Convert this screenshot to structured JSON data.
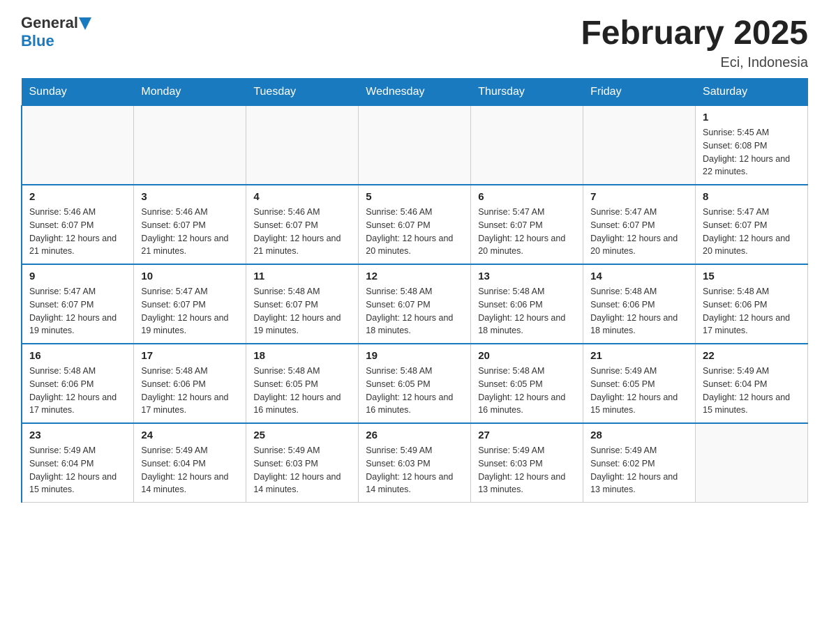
{
  "header": {
    "logo_general": "General",
    "logo_blue": "Blue",
    "title": "February 2025",
    "subtitle": "Eci, Indonesia"
  },
  "days_of_week": [
    "Sunday",
    "Monday",
    "Tuesday",
    "Wednesday",
    "Thursday",
    "Friday",
    "Saturday"
  ],
  "weeks": [
    {
      "cells": [
        {
          "day": "",
          "info": ""
        },
        {
          "day": "",
          "info": ""
        },
        {
          "day": "",
          "info": ""
        },
        {
          "day": "",
          "info": ""
        },
        {
          "day": "",
          "info": ""
        },
        {
          "day": "",
          "info": ""
        },
        {
          "day": "1",
          "info": "Sunrise: 5:45 AM\nSunset: 6:08 PM\nDaylight: 12 hours and 22 minutes."
        }
      ]
    },
    {
      "cells": [
        {
          "day": "2",
          "info": "Sunrise: 5:46 AM\nSunset: 6:07 PM\nDaylight: 12 hours and 21 minutes."
        },
        {
          "day": "3",
          "info": "Sunrise: 5:46 AM\nSunset: 6:07 PM\nDaylight: 12 hours and 21 minutes."
        },
        {
          "day": "4",
          "info": "Sunrise: 5:46 AM\nSunset: 6:07 PM\nDaylight: 12 hours and 21 minutes."
        },
        {
          "day": "5",
          "info": "Sunrise: 5:46 AM\nSunset: 6:07 PM\nDaylight: 12 hours and 20 minutes."
        },
        {
          "day": "6",
          "info": "Sunrise: 5:47 AM\nSunset: 6:07 PM\nDaylight: 12 hours and 20 minutes."
        },
        {
          "day": "7",
          "info": "Sunrise: 5:47 AM\nSunset: 6:07 PM\nDaylight: 12 hours and 20 minutes."
        },
        {
          "day": "8",
          "info": "Sunrise: 5:47 AM\nSunset: 6:07 PM\nDaylight: 12 hours and 20 minutes."
        }
      ]
    },
    {
      "cells": [
        {
          "day": "9",
          "info": "Sunrise: 5:47 AM\nSunset: 6:07 PM\nDaylight: 12 hours and 19 minutes."
        },
        {
          "day": "10",
          "info": "Sunrise: 5:47 AM\nSunset: 6:07 PM\nDaylight: 12 hours and 19 minutes."
        },
        {
          "day": "11",
          "info": "Sunrise: 5:48 AM\nSunset: 6:07 PM\nDaylight: 12 hours and 19 minutes."
        },
        {
          "day": "12",
          "info": "Sunrise: 5:48 AM\nSunset: 6:07 PM\nDaylight: 12 hours and 18 minutes."
        },
        {
          "day": "13",
          "info": "Sunrise: 5:48 AM\nSunset: 6:06 PM\nDaylight: 12 hours and 18 minutes."
        },
        {
          "day": "14",
          "info": "Sunrise: 5:48 AM\nSunset: 6:06 PM\nDaylight: 12 hours and 18 minutes."
        },
        {
          "day": "15",
          "info": "Sunrise: 5:48 AM\nSunset: 6:06 PM\nDaylight: 12 hours and 17 minutes."
        }
      ]
    },
    {
      "cells": [
        {
          "day": "16",
          "info": "Sunrise: 5:48 AM\nSunset: 6:06 PM\nDaylight: 12 hours and 17 minutes."
        },
        {
          "day": "17",
          "info": "Sunrise: 5:48 AM\nSunset: 6:06 PM\nDaylight: 12 hours and 17 minutes."
        },
        {
          "day": "18",
          "info": "Sunrise: 5:48 AM\nSunset: 6:05 PM\nDaylight: 12 hours and 16 minutes."
        },
        {
          "day": "19",
          "info": "Sunrise: 5:48 AM\nSunset: 6:05 PM\nDaylight: 12 hours and 16 minutes."
        },
        {
          "day": "20",
          "info": "Sunrise: 5:48 AM\nSunset: 6:05 PM\nDaylight: 12 hours and 16 minutes."
        },
        {
          "day": "21",
          "info": "Sunrise: 5:49 AM\nSunset: 6:05 PM\nDaylight: 12 hours and 15 minutes."
        },
        {
          "day": "22",
          "info": "Sunrise: 5:49 AM\nSunset: 6:04 PM\nDaylight: 12 hours and 15 minutes."
        }
      ]
    },
    {
      "cells": [
        {
          "day": "23",
          "info": "Sunrise: 5:49 AM\nSunset: 6:04 PM\nDaylight: 12 hours and 15 minutes."
        },
        {
          "day": "24",
          "info": "Sunrise: 5:49 AM\nSunset: 6:04 PM\nDaylight: 12 hours and 14 minutes."
        },
        {
          "day": "25",
          "info": "Sunrise: 5:49 AM\nSunset: 6:03 PM\nDaylight: 12 hours and 14 minutes."
        },
        {
          "day": "26",
          "info": "Sunrise: 5:49 AM\nSunset: 6:03 PM\nDaylight: 12 hours and 14 minutes."
        },
        {
          "day": "27",
          "info": "Sunrise: 5:49 AM\nSunset: 6:03 PM\nDaylight: 12 hours and 13 minutes."
        },
        {
          "day": "28",
          "info": "Sunrise: 5:49 AM\nSunset: 6:02 PM\nDaylight: 12 hours and 13 minutes."
        },
        {
          "day": "",
          "info": ""
        }
      ]
    }
  ]
}
